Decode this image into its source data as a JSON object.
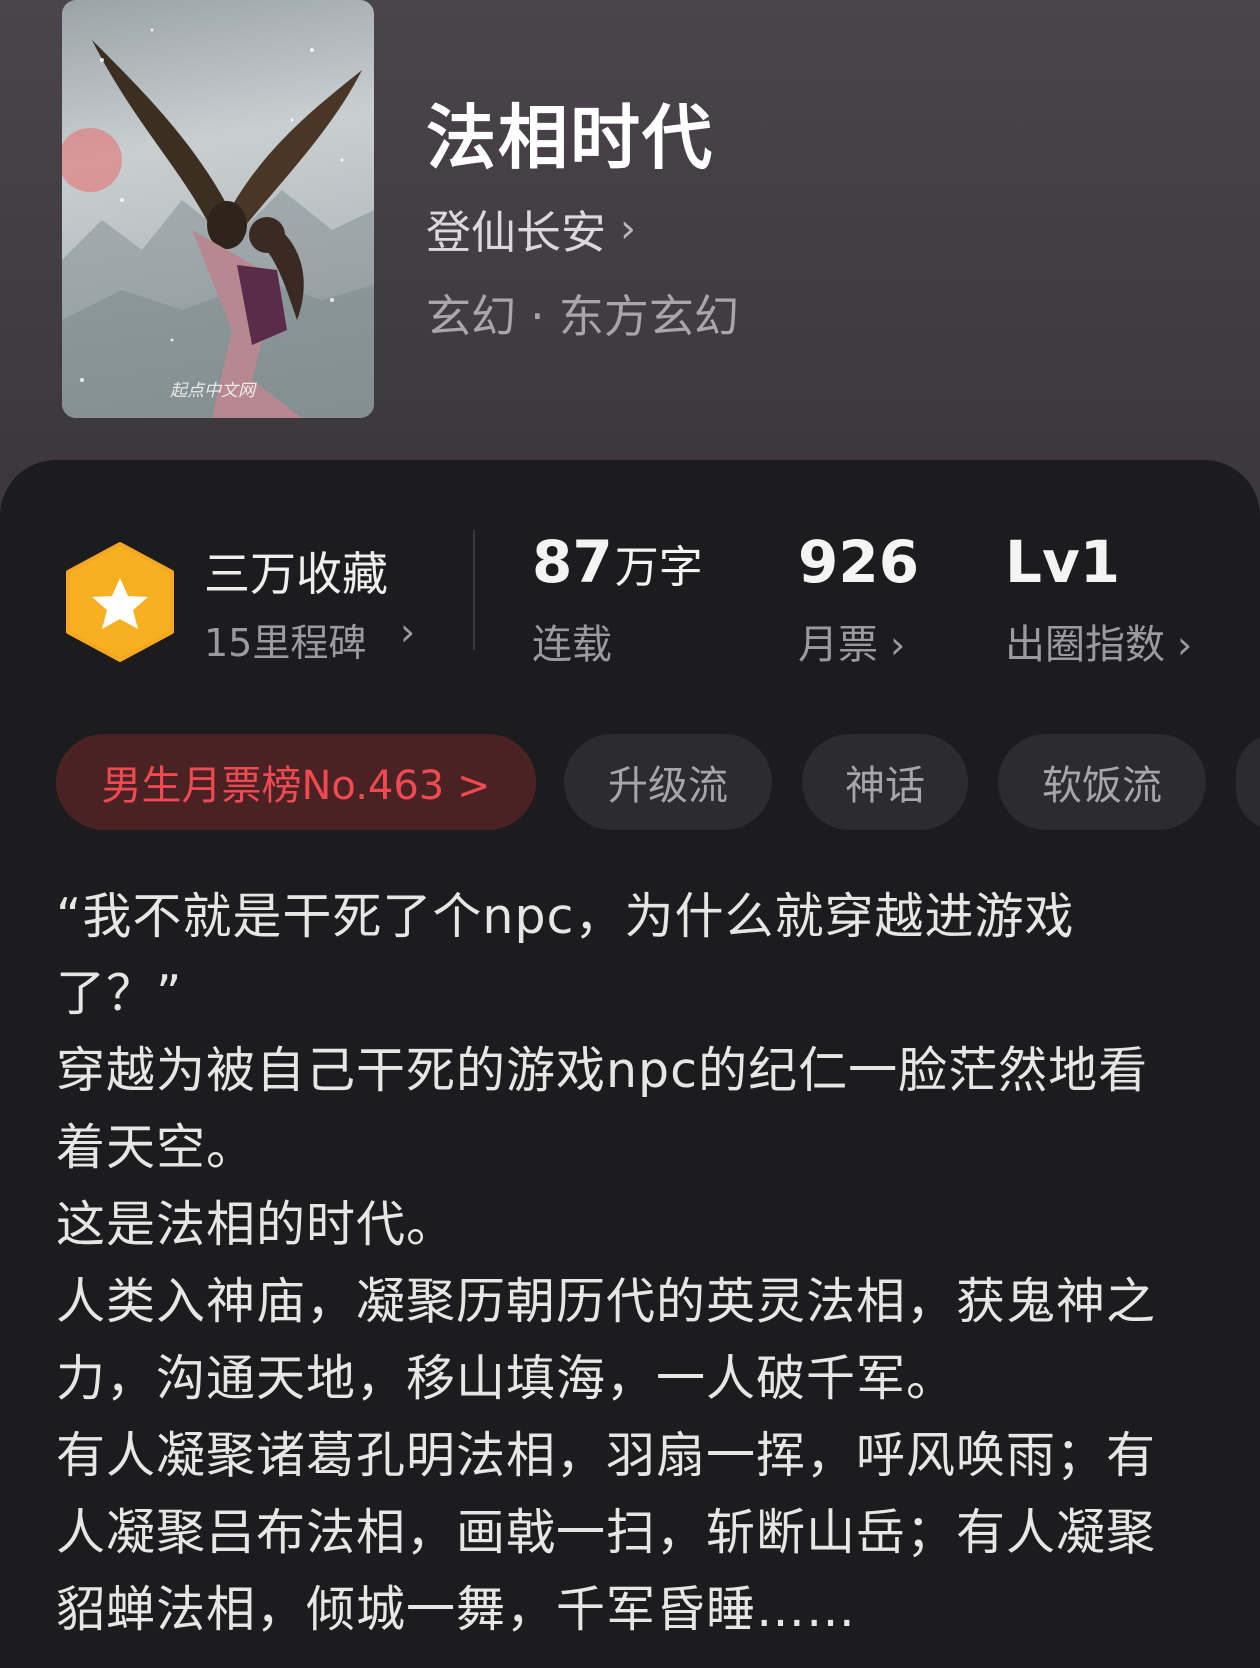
{
  "book": {
    "title": "法相时代",
    "author": "登仙长安",
    "genre": "玄幻 · 东方玄幻",
    "cover_watermark": "起点中文网"
  },
  "stats": {
    "favorites": {
      "title": "三万收藏",
      "subtitle": "15里程碑"
    },
    "words": {
      "value": "87",
      "unit": "万字",
      "label": "连载"
    },
    "monthly_tickets": {
      "value": "926",
      "label": "月票"
    },
    "breakout_index": {
      "value": "Lv1",
      "label": "出圈指数"
    }
  },
  "tags": [
    {
      "label": "男生月票榜No.463 >"
    },
    {
      "label": "升级流"
    },
    {
      "label": "神话"
    },
    {
      "label": "软饭流"
    }
  ],
  "synopsis": [
    "“我不就是干死了个npc，为什么就穿越进游戏了？”",
    "穿越为被自己干死的游戏npc的纪仁一脸茫然地看着天空。",
    "这是法相的时代。",
    "人类入神庙，凝聚历朝历代的英灵法相，获鬼神之力，沟通天地，移山填海，一人破千军。",
    "有人凝聚诸葛孔明法相，羽扇一挥，呼风唤雨；有人凝聚吕布法相，画戟一扫，斩断山岳；有人凝聚貂蝉法相，倾城一舞，千军昏睡……"
  ],
  "icons": {
    "chevron": "chevron-right-icon",
    "badge": "star-hexagon-icon"
  },
  "colors": {
    "accent_red": "#ef4a51",
    "badge_orange": "#f7b021"
  }
}
